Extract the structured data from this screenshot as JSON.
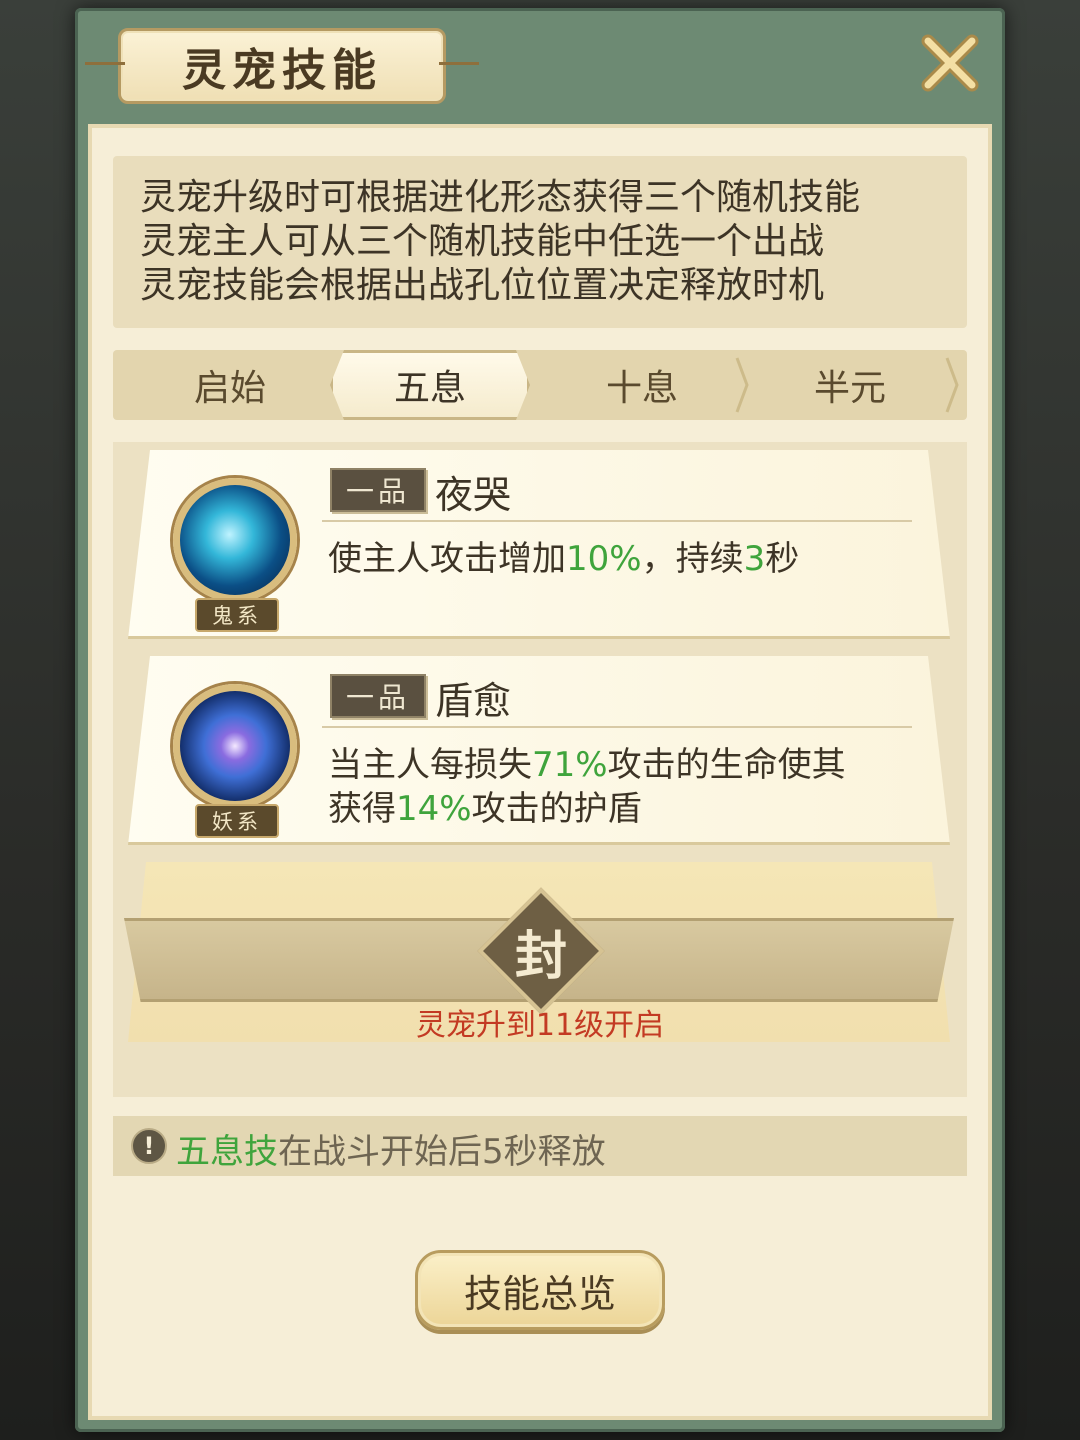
{
  "title": "灵宠技能",
  "description": [
    "灵宠升级时可根据进化形态获得三个随机技能",
    "灵宠主人可从三个随机技能中任选一个出战",
    "灵宠技能会根据出战孔位位置决定释放时机"
  ],
  "tabs": [
    {
      "label": "启始",
      "active": false
    },
    {
      "label": "五息",
      "active": true
    },
    {
      "label": "十息",
      "active": false
    },
    {
      "label": "半元",
      "active": false
    }
  ],
  "skills": [
    {
      "type": "鬼系",
      "icon": "water-drop-spirit-icon",
      "grade": "一品",
      "name": "夜哭",
      "desc": [
        {
          "t": "使主人攻击增加",
          "green": false
        },
        {
          "t": "10%",
          "green": true
        },
        {
          "t": "，持续",
          "green": false
        },
        {
          "t": "3",
          "green": true
        },
        {
          "t": "秒",
          "green": false
        }
      ]
    },
    {
      "type": "妖系",
      "icon": "vortex-spirit-icon",
      "grade": "一品",
      "name": "盾愈",
      "desc_line1": [
        {
          "t": "当主人每损失",
          "green": false
        },
        {
          "t": "71%",
          "green": true
        },
        {
          "t": "攻击的生命使其",
          "green": false
        }
      ],
      "desc_line2": [
        {
          "t": "获得",
          "green": false
        },
        {
          "t": "14%",
          "green": true
        },
        {
          "t": "攻击的护盾",
          "green": false
        }
      ]
    }
  ],
  "locked_slot": {
    "seal": "封",
    "unlock_text": "灵宠升到11级开启"
  },
  "tip": {
    "icon": "exclamation-icon",
    "highlight": "五息技",
    "rest": "在战斗开始后5秒释放"
  },
  "overview_button": "技能总览",
  "colors": {
    "frame_green": "#6d8a73",
    "parchment": "#f6eed7",
    "value_green": "#3fa43c",
    "unlock_red": "#c33a23"
  }
}
